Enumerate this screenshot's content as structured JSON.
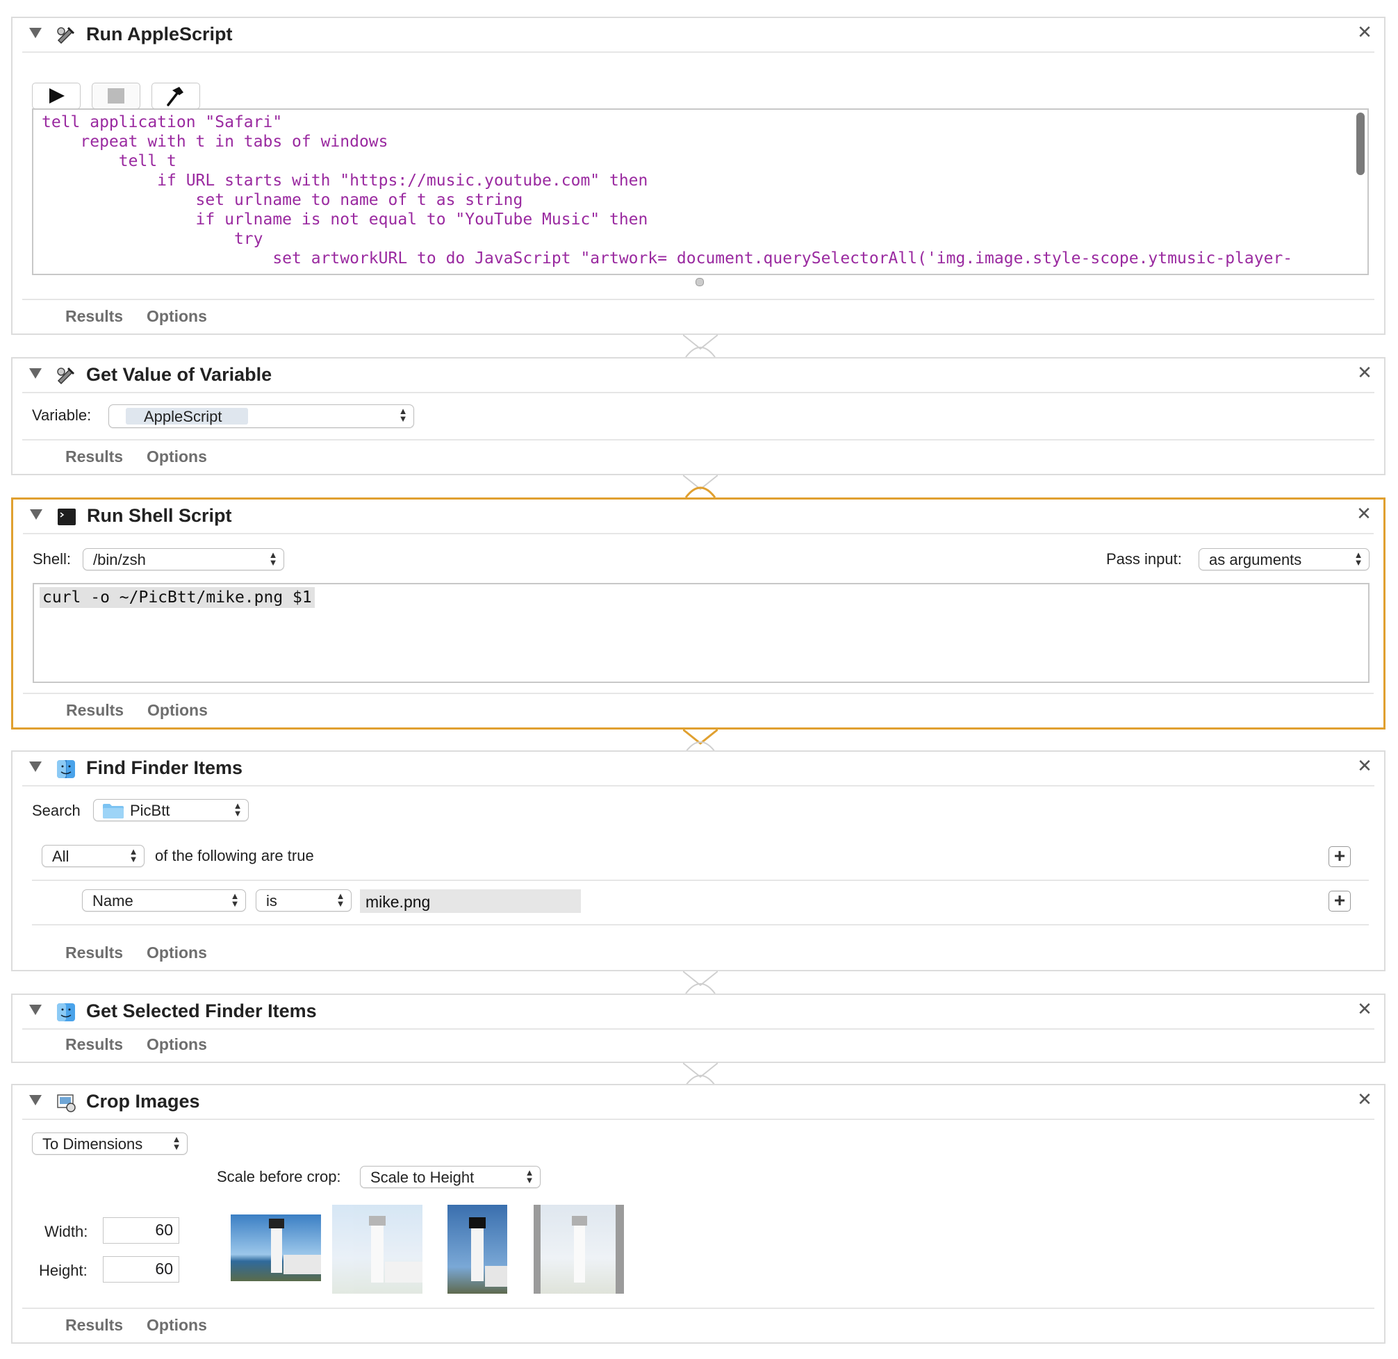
{
  "footer": {
    "results_label": "Results",
    "options_label": "Options"
  },
  "close_glyph": "✕",
  "actions": {
    "run_applescript": {
      "title": "Run AppleScript",
      "code_lines": [
        "tell application \"Safari\"",
        "    repeat with t in tabs of windows",
        "        tell t",
        "            if URL starts with \"https://music.youtube.com\" then",
        "                set urlname to name of t as string",
        "                if urlname is not equal to \"YouTube Music\" then",
        "                    try",
        "                        set artworkURL to do JavaScript \"artwork= document.querySelectorAll('img.image.style-scope.ytmusic-player-"
      ]
    },
    "get_value_of_variable": {
      "title": "Get Value of Variable",
      "variable_label": "Variable:",
      "variable_value": "AppleScript"
    },
    "run_shell_script": {
      "title": "Run Shell Script",
      "shell_label": "Shell:",
      "shell_value": "/bin/zsh",
      "pass_input_label": "Pass input:",
      "pass_input_value": "as arguments",
      "script": "curl -o ~/PicBtt/mike.png $1"
    },
    "find_finder_items": {
      "title": "Find Finder Items",
      "search_label": "Search",
      "search_location": "PicBtt",
      "match_value": "All",
      "match_text": "of the following are true",
      "criteria": {
        "field": "Name",
        "operator": "is",
        "value": "mike.png"
      }
    },
    "get_selected_finder_items": {
      "title": "Get Selected Finder Items"
    },
    "crop_images": {
      "title": "Crop Images",
      "mode_value": "To Dimensions",
      "scale_label": "Scale before crop:",
      "scale_value": "Scale to Height",
      "width_label": "Width:",
      "width_value": "60",
      "height_label": "Height:",
      "height_value": "60"
    }
  },
  "colors": {
    "code_text": "#9a2aa0",
    "selected_border": "#e0a030",
    "panel_border": "#dcdcdc"
  }
}
